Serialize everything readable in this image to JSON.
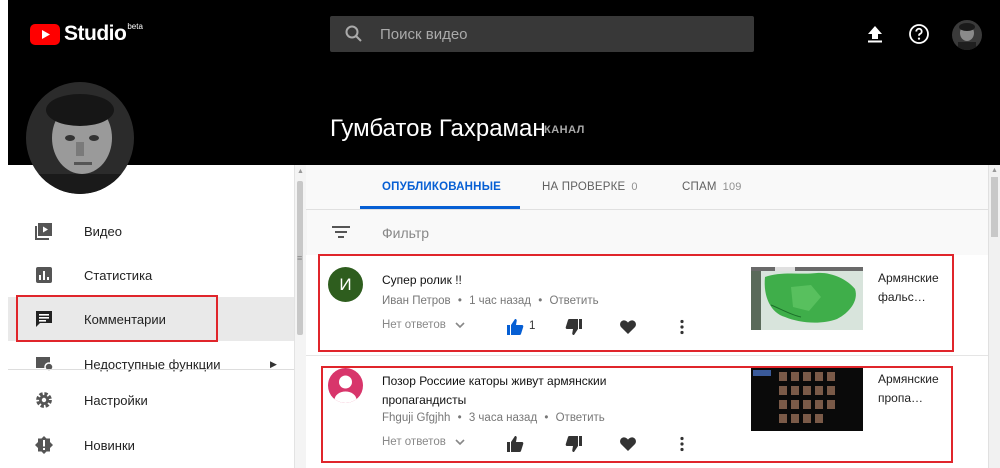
{
  "app": {
    "name": "Studio",
    "badge": "beta",
    "brand_color": "#ff0000"
  },
  "search": {
    "placeholder": "Поиск видео"
  },
  "channel": {
    "name": "Гумбатов Гахраман",
    "tag": "КАНАЛ"
  },
  "sidebar": {
    "items": [
      {
        "label": "Видео",
        "icon": "video-icon"
      },
      {
        "label": "Статистика",
        "icon": "analytics-icon"
      },
      {
        "label": "Комментарии",
        "icon": "comments-icon",
        "active": true
      },
      {
        "label": "Недоступные функции",
        "icon": "unavailable-features-icon",
        "has_arrow": true
      },
      {
        "label": "Настройки",
        "icon": "gear-icon"
      },
      {
        "label": "Новинки",
        "icon": "whats-new-icon"
      }
    ]
  },
  "tabs": [
    {
      "label": "ОПУБЛИКОВАННЫЕ",
      "count": "",
      "active": true
    },
    {
      "label": "НА ПРОВЕРКЕ",
      "count": "0"
    },
    {
      "label": "СПАМ",
      "count": "109"
    }
  ],
  "filter": {
    "label": "Фильтр"
  },
  "comments": [
    {
      "avatar_letter": "И",
      "avatar_color": "#2e5d1e",
      "text": "Супер ролик !!",
      "author": "Иван Петров",
      "time": "1 час назад",
      "reply": "Ответить",
      "replies_label": "Нет ответов",
      "likes": "1",
      "video_title": "Армянские фальс…"
    },
    {
      "avatar_color": "#d8356b",
      "text": "Позор Россиие каторы живут армянскии пропагандисты",
      "author": "Fhguji Gfgjhh",
      "time": "3 часа назад",
      "reply": "Ответить",
      "replies_label": "Нет ответов",
      "likes": "",
      "video_title": "Армянские пропа…"
    }
  ],
  "separator": "•",
  "colors": {
    "accent": "#065fd4",
    "highlight": "#e0252b",
    "header_bg": "#000000"
  }
}
